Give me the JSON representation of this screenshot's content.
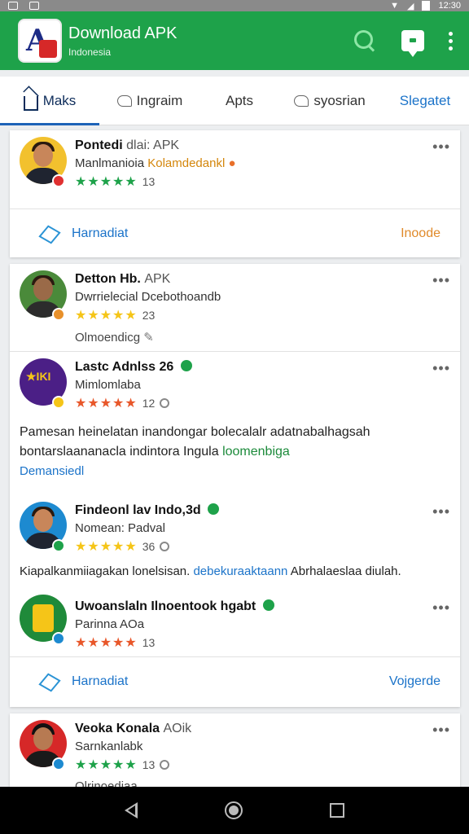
{
  "statusbar": {
    "time": "12:30"
  },
  "appbar": {
    "title": "Download APK",
    "subtitle": "Indonesia"
  },
  "tabs": [
    {
      "label": "Maks"
    },
    {
      "label": "Ingraim"
    },
    {
      "label": "Apts"
    },
    {
      "label": "syosrian"
    },
    {
      "label": "Slegatet"
    }
  ],
  "cards": [
    {
      "posts": [
        {
          "name": "Pontedi",
          "tag": "dlai: APK",
          "sub": "Manlmanioia",
          "sub_highlight": "Kolamdedankl",
          "stars": "★★★★★",
          "count": "13"
        }
      ],
      "footer": {
        "left": "Harnadiat",
        "right": "Inoode"
      }
    },
    {
      "posts": [
        {
          "name": "Detton Hb.",
          "tag": "APK",
          "sub": "Dwrrielecial Dcebothoandb",
          "stars": "★★★★★",
          "count": "23",
          "link": "Olmoendicg"
        },
        {
          "name": "Lastc Adnlss 26",
          "sub": "Mimlomlaba",
          "stars": "★★★★★",
          "count": "12",
          "body": "Pamesan heinelatan inandongar bolecalalr adatnabalhagsah bontarslaananacla indintora Ingula",
          "body_highlight": "loomenbiga",
          "more": "Demansiedl"
        },
        {
          "name": "Findeonl lav Indo,3d",
          "sub": "Nomean: Padval",
          "stars": "★★★★★",
          "count": "36",
          "body": "Kiapalkanmiiagakan lonelsisan.",
          "body_highlight": "debekuraaktaann",
          "body_tail": "Abrhalaeslaa diulah."
        },
        {
          "name": "Uwoanslaln Ilnoentook hgabt",
          "sub": "Parinna AOa",
          "stars": "★★★★★",
          "count": "13"
        }
      ],
      "footer": {
        "left": "Harnadiat",
        "right": "Vojgerde"
      }
    },
    {
      "posts": [
        {
          "name": "Veoka Konala",
          "tag": "AOik",
          "sub": "Sarnkanlabk",
          "stars": "★★★★★",
          "count": "13",
          "link": "Olrinoediaa"
        }
      ]
    }
  ],
  "colors": {
    "primary": "#1ea24a",
    "tab_indicator": "#1e63b8",
    "link": "#1b73c9",
    "star_green": "#1ea24a",
    "star_yellow": "#f5c518",
    "star_orange": "#e8572a",
    "highlight_orange": "#d4860b"
  }
}
